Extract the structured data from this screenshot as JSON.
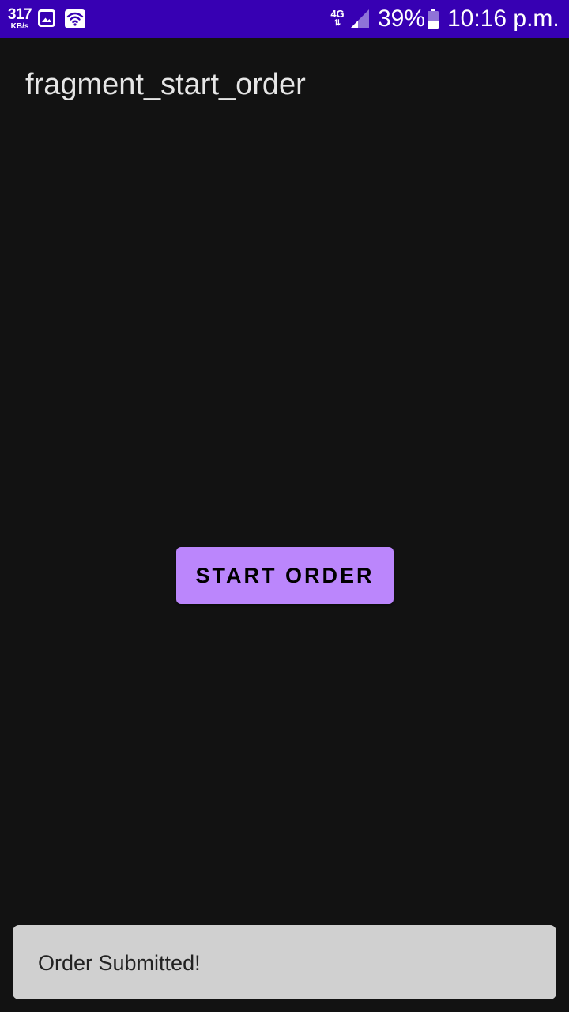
{
  "status_bar": {
    "background_color": "#3700b3",
    "data_speed_value": "317",
    "data_speed_unit": "KB/s",
    "network_type": "4G",
    "network_arrows": "⇅",
    "battery_percent": "39%",
    "time": "10:16 p.m.",
    "icons": [
      "image-icon",
      "wifi-icon",
      "signal-icon",
      "battery-icon"
    ]
  },
  "page": {
    "title": "fragment_start_order",
    "background_color": "#121212"
  },
  "actions": {
    "start_order_label": "START ORDER",
    "button_color": "#bb86fc"
  },
  "toast": {
    "message": "Order Submitted!",
    "background_color": "#d0d0d0"
  }
}
